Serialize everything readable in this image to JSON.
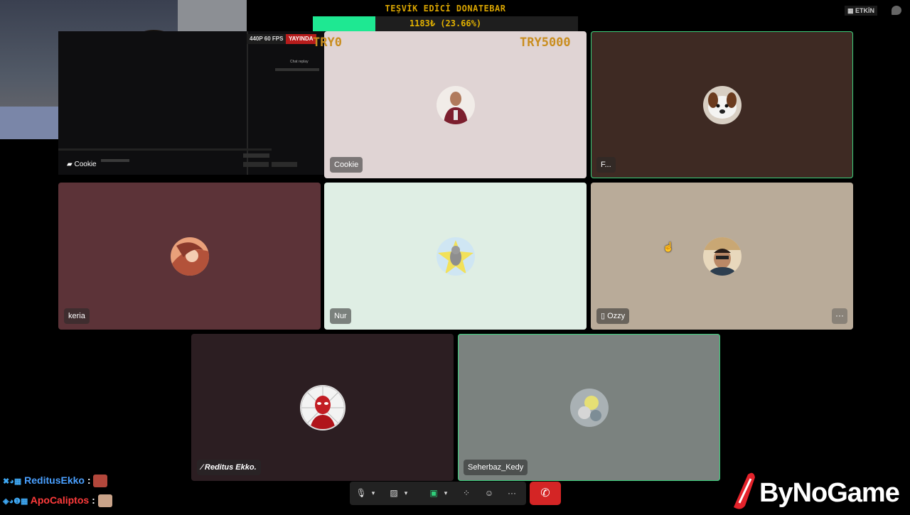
{
  "donatebar": {
    "title": "TEŞVİK EDİCİ DONATEBAR",
    "amount": "1183₺ (23.66%)",
    "progress_percent": 23.66,
    "min_label": "TRY0",
    "goal_label": "TRY5000",
    "fill_color": "#1ee892"
  },
  "status": {
    "active_label": "ETKİN"
  },
  "stream_preview": {
    "resolution": "440P 60 FPS",
    "live_badge": "YAYINDA",
    "chat_title": "Chat replay",
    "overlay_name": "Cookie"
  },
  "participants": [
    {
      "name": "Cookie",
      "bg": "#e0d4d4",
      "avatar_desc": "person-in-jersey"
    },
    {
      "name": "F...",
      "bg": "#3e2a23",
      "avatar_desc": "dog"
    },
    {
      "name": "keria",
      "bg": "#5c3338",
      "avatar_desc": "anime-art"
    },
    {
      "name": "Nur",
      "bg": "#dfeee4",
      "avatar_desc": "cat"
    },
    {
      "name": "Ozzy",
      "bg": "#b9ab99",
      "avatar_desc": "selfie"
    },
    {
      "name": "Reditus Ekko.",
      "bg": "#2c1e22",
      "avatar_desc": "spider-hero"
    },
    {
      "name": "Seherbaz_Kedy",
      "bg": "#7b827f",
      "avatar_desc": "flowers"
    }
  ],
  "toolbar": {
    "mic_icon": "microphone-icon",
    "camera_icon": "camera-off-icon",
    "share_icon": "screen-share-icon",
    "apps_icon": "apps-icon",
    "reactions_icon": "reactions-icon",
    "more_icon": "more-icon",
    "end_icon": "end-call-icon",
    "more_glyph": "···",
    "end_glyph": "✆"
  },
  "chat": [
    {
      "user": "ReditusEkko",
      "sep": ":",
      "color": "#4aa0ff"
    },
    {
      "user": "ApoCaliptos",
      "sep": ":",
      "color": "#ff3b3b"
    }
  ],
  "brand": {
    "text": "ByNoGame",
    "accent": "#e4232b"
  }
}
